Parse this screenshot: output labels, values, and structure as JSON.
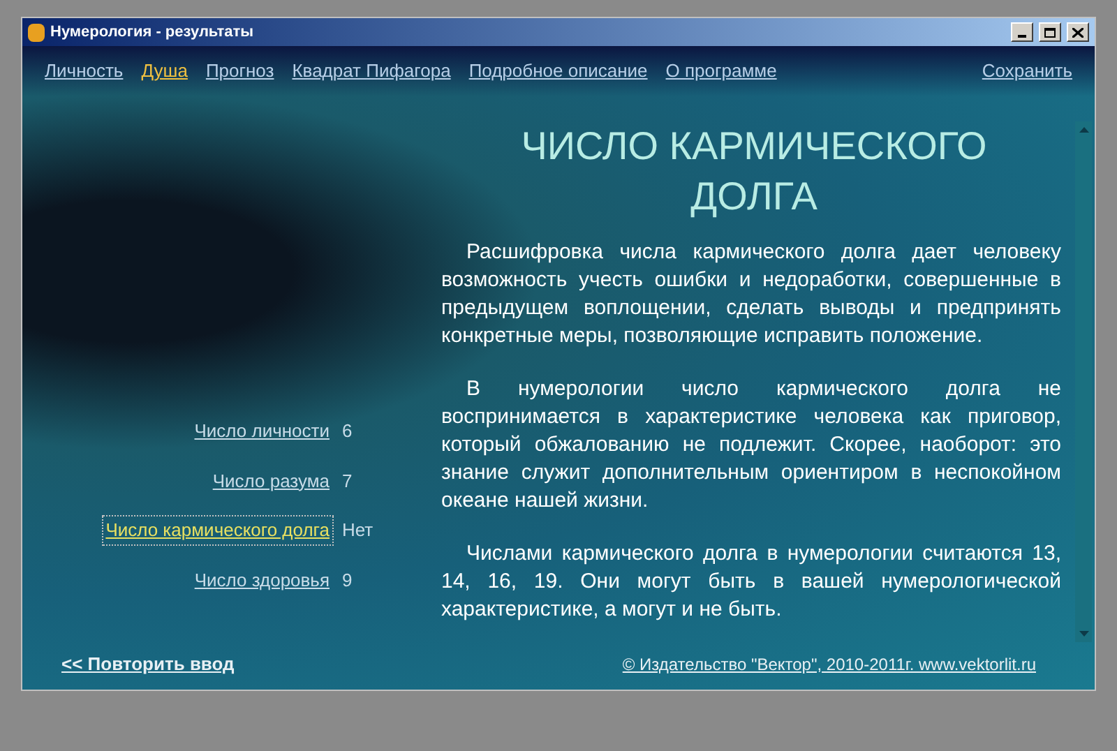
{
  "window": {
    "title": "Нумерология - результаты"
  },
  "menu": [
    {
      "label": "Личность",
      "selected": false
    },
    {
      "label": "Душа",
      "selected": true
    },
    {
      "label": "Прогноз",
      "selected": false
    },
    {
      "label": "Квадрат Пифагора",
      "selected": false
    },
    {
      "label": "Подробное описание",
      "selected": false
    },
    {
      "label": "О программе",
      "selected": false
    }
  ],
  "save_link": "Сохранить",
  "numbers": [
    {
      "label": "Число личности",
      "value": "6",
      "selected": false
    },
    {
      "label": "Число разума",
      "value": "7",
      "selected": false
    },
    {
      "label": "Число кармического долга",
      "value": "Нет",
      "selected": true
    },
    {
      "label": "Число здоровья",
      "value": "9",
      "selected": false
    }
  ],
  "heading": "ЧИСЛО КАРМИЧЕСКОГО ДОЛГА",
  "paragraphs": [
    "Расшифровка числа кармического долга дает человеку возможность учесть ошибки и недоработки, совершенные в предыдущем воплощении, сделать выводы и предпринять конкретные меры, позволяющие исправить положение.",
    "В нумерологии число кармического долга не воспринимается в характеристике человека как приговор, который обжалованию не подлежит. Скорее, наоборот: это знание служит дополнительным ориентиром в неспокойном океане нашей жизни.",
    "Числами кармического долга в нумерологии считаются 13, 14, 16, 19. Они могут быть в вашей нумерологической характеристике, а могут и не быть."
  ],
  "repeat_link": "<< Повторить ввод",
  "copyright": "© Издательство \"Вектор\", 2010-2011г. www.vektorlit.ru"
}
